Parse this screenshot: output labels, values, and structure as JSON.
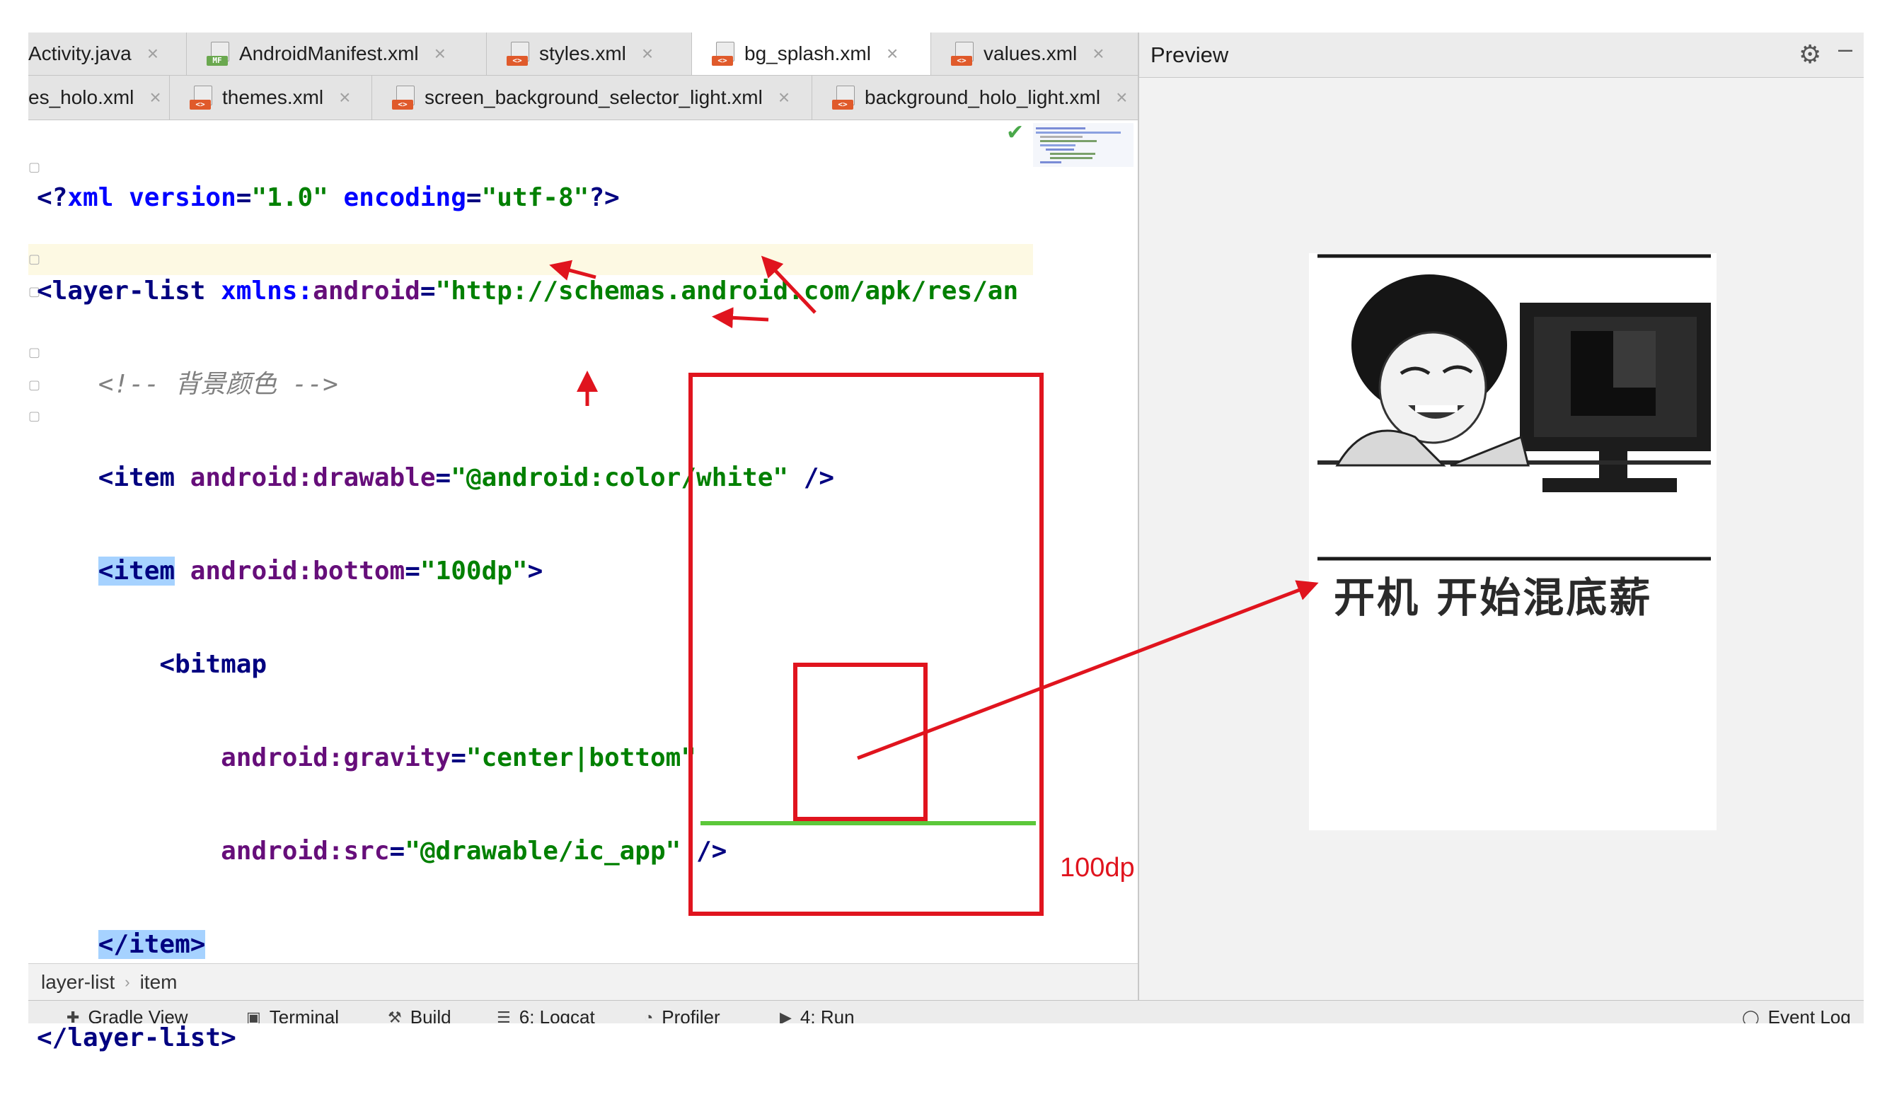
{
  "tabs_row1": [
    {
      "label": "Activity.java",
      "icon": null,
      "active": false
    },
    {
      "label": "AndroidManifest.xml",
      "icon": "manifest-file-icon",
      "active": false
    },
    {
      "label": "styles.xml",
      "icon": "xml-file-icon",
      "active": false
    },
    {
      "label": "bg_splash.xml",
      "icon": "xml-file-icon",
      "active": true
    },
    {
      "label": "values.xml",
      "icon": "xml-file-icon",
      "active": false
    }
  ],
  "tabs_row2": [
    {
      "label": "es_holo.xml",
      "icon": null
    },
    {
      "label": "themes.xml",
      "icon": "xml-file-icon"
    },
    {
      "label": "screen_background_selector_light.xml",
      "icon": "xml-file-icon"
    },
    {
      "label": "background_holo_light.xml",
      "icon": "xml-file-icon"
    }
  ],
  "tab_close_glyph": "×",
  "badges": {
    "xml": "<>",
    "manifest": "MF"
  },
  "code": {
    "l1_open": "<?",
    "l1_xml": "xml",
    "l1_version_attr": " version",
    "l1_eq1": "=",
    "l1_version_val": "\"1.0\"",
    "l1_encoding_attr": " encoding",
    "l1_eq2": "=",
    "l1_encoding_val": "\"utf-8\"",
    "l1_close": "?>",
    "l2_tag": "<layer-list",
    "l2_ns": " xmlns:",
    "l2_attr": "android",
    "l2_eq": "=",
    "l2_val": "\"http://schemas.android.com/apk/res/an",
    "l3_comment": "    <!-- 背景颜色 -->",
    "l4_tag": "    <item",
    "l4_attr": " android:drawable",
    "l4_eq": "=",
    "l4_val": "\"@android:color/white\"",
    "l4_close": " />",
    "l5_indent": "    ",
    "l5_tag": "<item",
    "l5_attr": " android:bottom",
    "l5_eq": "=",
    "l5_val": "\"100dp\"",
    "l5_close": ">",
    "l6_tag": "        <bitmap",
    "l7_attr": "            android:gravity",
    "l7_eq": "=",
    "l7_val": "\"center|bottom\"",
    "l8_attr": "            android:src",
    "l8_eq": "=",
    "l8_val": "\"@drawable/ic_app\"",
    "l8_close": " />",
    "l9_indent": "    ",
    "l9_tag": "</item>",
    "l10_tag": "</layer-list>"
  },
  "breadcrumb": [
    "layer-list",
    "item"
  ],
  "breadcrumb_sep": "›",
  "bottom_toolbar": [
    {
      "label": "Gradle View",
      "icon": "plus-icon",
      "glyph": "✚"
    },
    {
      "label": "Terminal",
      "icon": "terminal-icon",
      "glyph": "▣"
    },
    {
      "label": "Build",
      "icon": "hammer-icon",
      "glyph": "⚒"
    },
    {
      "label": "6: Logcat",
      "icon": "logcat-icon",
      "glyph": "☰"
    },
    {
      "label": "Profiler",
      "icon": "profiler-icon",
      "glyph": "◔"
    },
    {
      "label": "4: Run",
      "icon": "run-icon",
      "glyph": "▶"
    },
    {
      "label": "Event Log",
      "icon": "event-log-icon",
      "glyph": "◯"
    }
  ],
  "preview": {
    "title": "Preview",
    "gear_glyph": "⚙",
    "minimize_glyph": "–",
    "caption": "开机 开始混底薪"
  },
  "annotation": {
    "label": "100dp",
    "colors": {
      "arrow": "#e0141e",
      "bottom_line": "#5cc83a"
    }
  },
  "checkmark": "✔"
}
